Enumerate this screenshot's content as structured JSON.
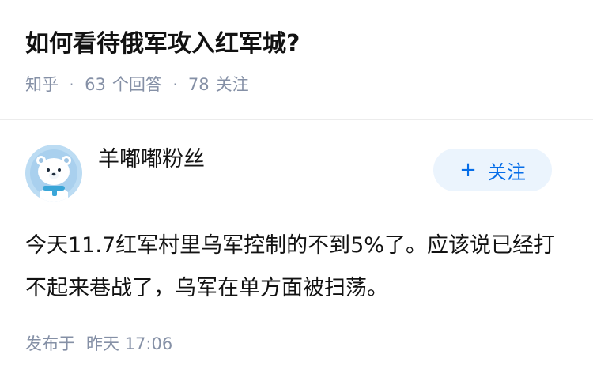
{
  "question": {
    "title": "如何看待俄军攻入红军城?",
    "source": "知乎",
    "answer_count": "63",
    "answer_count_label": "个回答",
    "follower_count": "78",
    "follower_label": "关注",
    "separator": "·"
  },
  "answer": {
    "author_name": "羊嘟嘟粉丝",
    "avatar_icon": "polar-bear-avatar-icon",
    "follow_button": {
      "icon": "+",
      "label": "关注"
    },
    "content": "今天11.7红军村里乌军控制的不到5%了。应该说已经打不起来巷战了，乌军在单方面被扫荡。",
    "posted_label": "发布于",
    "posted_time": "昨天 17:06"
  },
  "colors": {
    "accent": "#056de8",
    "follow_bg": "#ebf4fd",
    "meta_text": "#8590a6",
    "title_text": "#121212"
  }
}
